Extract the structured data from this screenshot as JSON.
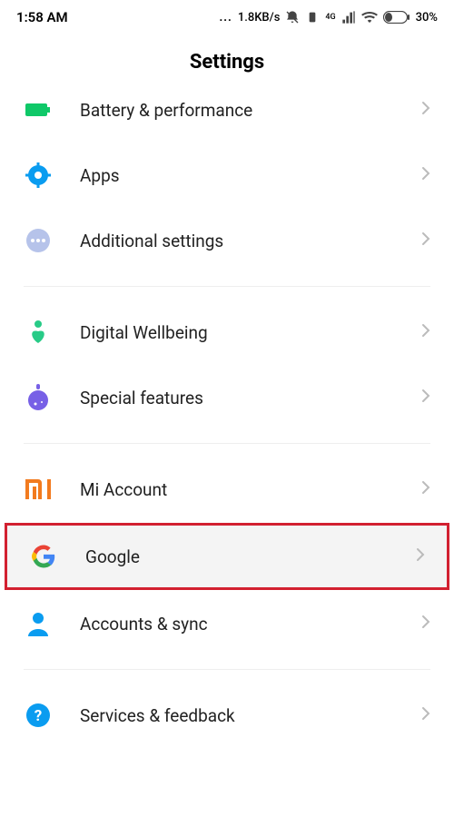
{
  "status": {
    "time": "1:58 AM",
    "speed": "1.8KB/s",
    "battery": "30%",
    "network": "4G"
  },
  "title": "Settings",
  "sections": [
    {
      "items": [
        {
          "key": "battery",
          "label": "Battery & performance"
        },
        {
          "key": "apps",
          "label": "Apps"
        },
        {
          "key": "additional",
          "label": "Additional settings"
        }
      ]
    },
    {
      "items": [
        {
          "key": "wellbeing",
          "label": "Digital Wellbeing"
        },
        {
          "key": "special",
          "label": "Special features"
        }
      ]
    },
    {
      "items": [
        {
          "key": "mi",
          "label": "Mi Account"
        },
        {
          "key": "google",
          "label": "Google",
          "highlighted": true
        },
        {
          "key": "accounts",
          "label": "Accounts & sync"
        }
      ]
    },
    {
      "items": [
        {
          "key": "services",
          "label": "Services & feedback"
        }
      ]
    }
  ]
}
